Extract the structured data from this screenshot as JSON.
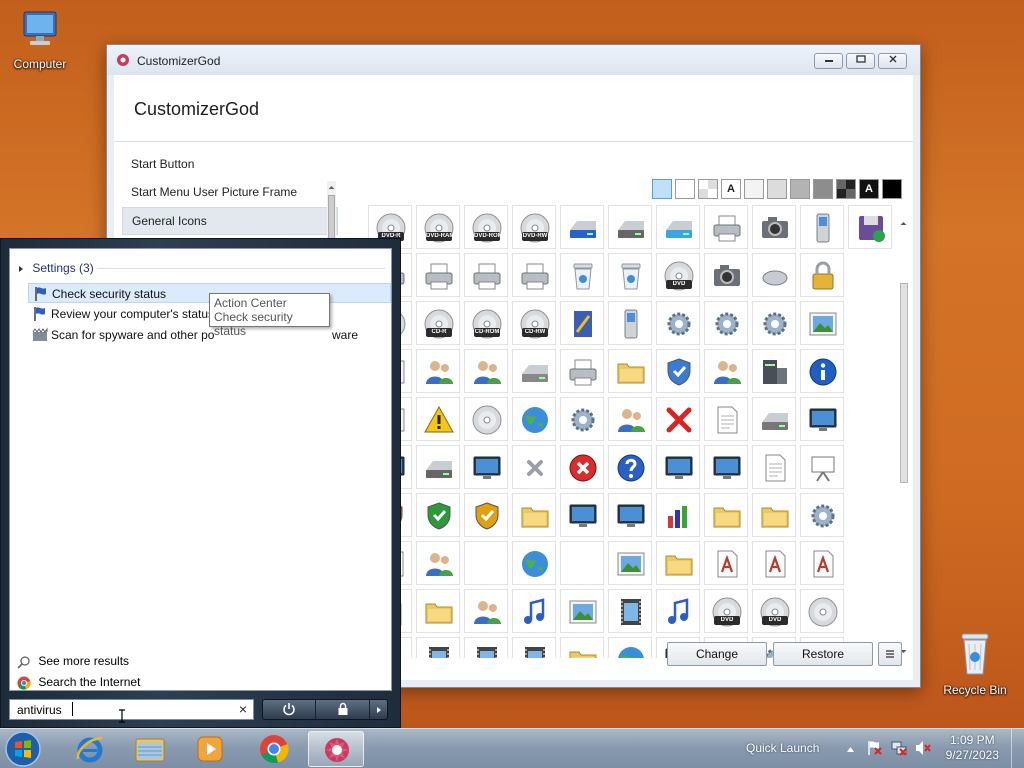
{
  "desktop": {
    "computer_label": "Computer",
    "recycle_label": "Recycle Bin"
  },
  "window": {
    "title": "CustomizerGod",
    "header": "CustomizerGod",
    "sidebar": [
      "Start Button",
      "Start Menu User Picture Frame",
      "General Icons"
    ],
    "selected_index": 2,
    "swatch_labels": [
      "A",
      "A"
    ],
    "change_label": "Change",
    "restore_label": "Restore",
    "icon_labels": [
      "DVD-R",
      "DVD-RAM",
      "DVD-ROM",
      "DVD-RW",
      "CD-R",
      "CD-ROM",
      "CD-RW",
      "DVD"
    ]
  },
  "start_menu": {
    "group_title": "Settings (3)",
    "results": [
      "Check security status",
      "Review your computer's status",
      "Scan for spyware and other po"
    ],
    "result3_tail": "ware",
    "tooltip_line1": "Action Center",
    "tooltip_line2": "Check security status",
    "see_more": "See more results",
    "search_internet": "Search the Internet",
    "search_value": "antivirus",
    "clear_symbol": "×"
  },
  "taskbar": {
    "quick_launch": "Quick Launch",
    "time": "1:09 PM",
    "date": "9/27/2023"
  },
  "colors": {
    "accent": "#1e3287",
    "highlight": "#dcebfc",
    "desktop": "#cf6a22"
  }
}
